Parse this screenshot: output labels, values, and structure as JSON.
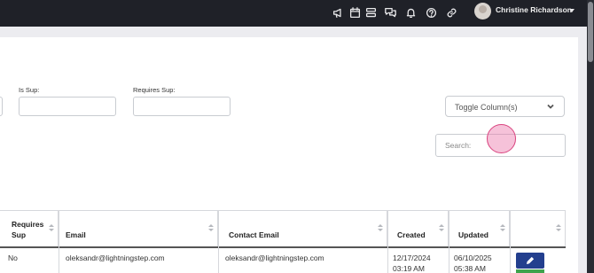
{
  "topbar": {
    "icons": [
      "megaphone-icon",
      "calendar-icon",
      "layers-icon",
      "chat-icon",
      "bell-icon",
      "help-icon",
      "link-icon"
    ],
    "user_name": "Christine Richardson"
  },
  "filters": {
    "is_sup_label": "Is Sup:",
    "requires_sup_label": "Requires Sup:",
    "toggle_columns_label": "Toggle Column(s)",
    "search_placeholder": "Search:"
  },
  "table": {
    "headers": {
      "requires_sup_line1": "Requires",
      "requires_sup_line2": "Sup",
      "email": "Email",
      "contact_email": "Contact Email",
      "created": "Created",
      "updated": "Updated"
    },
    "rows": [
      {
        "requires_sup": "No",
        "email": "oleksandr@lightningstep.com",
        "contact_email": "oleksandr@lightningstep.com",
        "created_date": "12/17/2024",
        "created_time": "03:19 AM",
        "updated_date": "06/10/2025",
        "updated_time": "05:38 AM"
      }
    ]
  }
}
